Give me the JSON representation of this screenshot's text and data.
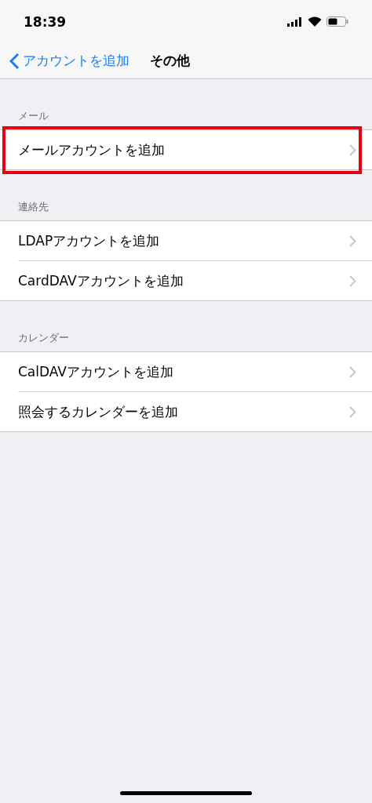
{
  "status_bar": {
    "time": "18:39"
  },
  "nav": {
    "back_label": "アカウントを追加",
    "title": "その他"
  },
  "sections": [
    {
      "header": "メール",
      "rows": [
        {
          "label": "メールアカウントを追加",
          "highlighted": true
        }
      ]
    },
    {
      "header": "連絡先",
      "rows": [
        {
          "label": "LDAPアカウントを追加",
          "highlighted": false
        },
        {
          "label": "CardDAVアカウントを追加",
          "highlighted": false
        }
      ]
    },
    {
      "header": "カレンダー",
      "rows": [
        {
          "label": "CalDAVアカウントを追加",
          "highlighted": false
        },
        {
          "label": "照会するカレンダーを追加",
          "highlighted": false
        }
      ]
    }
  ]
}
